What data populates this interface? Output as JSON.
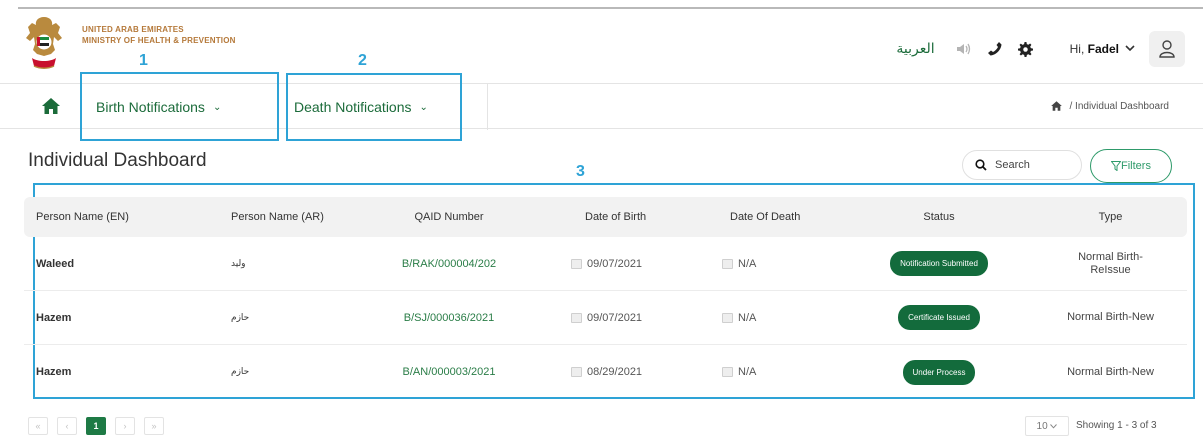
{
  "header": {
    "ministry_line1": "UNITED ARAB EMIRATES",
    "ministry_line2": "MINISTRY OF HEALTH & PREVENTION",
    "language_link": "العربية",
    "greeting_prefix": "Hi,",
    "user_name": "Fadel",
    "icons": [
      "emblem-logo",
      "speaker-icon",
      "phone-icon",
      "gear-icon",
      "chevron-down-icon",
      "user-icon"
    ]
  },
  "nav": {
    "items": [
      {
        "label": "Birth Notifications"
      },
      {
        "label": "Death Notifications"
      }
    ],
    "breadcrumb_separator": "/",
    "breadcrumb_current": "Individual Dashboard"
  },
  "annotations": [
    "1",
    "2",
    "3"
  ],
  "page": {
    "title": "Individual Dashboard",
    "search_placeholder": "Search",
    "filters_label": "Filters"
  },
  "table": {
    "headers": [
      "Person Name (EN)",
      "Person Name (AR)",
      "QAID Number",
      "Date of Birth",
      "Date Of Death",
      "Status",
      "Type"
    ],
    "rows": [
      {
        "name_en": "Waleed",
        "name_ar": "وليد",
        "qaid": "B/RAK/000004/202",
        "dob": "09/07/2021",
        "dod": "N/A",
        "status": "Notification Submitted",
        "type_line1": "Normal Birth-",
        "type_line2": "ReIssue"
      },
      {
        "name_en": "Hazem",
        "name_ar": "حازم",
        "qaid": "B/SJ/000036/2021",
        "dob": "09/07/2021",
        "dod": "N/A",
        "status": "Certificate Issued",
        "type_line1": "Normal Birth-New",
        "type_line2": ""
      },
      {
        "name_en": "Hazem",
        "name_ar": "حازم",
        "qaid": "B/AN/000003/2021",
        "dob": "08/29/2021",
        "dod": "N/A",
        "status": "Under Process",
        "type_line1": "Normal Birth-New",
        "type_line2": ""
      }
    ]
  },
  "pagination": {
    "first": "«",
    "prev": "‹",
    "current": "1",
    "next": "›",
    "last": "»",
    "page_size": "10",
    "summary": "Showing 1 - 3 of 3"
  },
  "colors": {
    "brand_green": "#1b6b3a",
    "badge_green": "#136b3c",
    "annotation_blue": "#2ea3d6",
    "ministry_gold": "#b5793a"
  }
}
